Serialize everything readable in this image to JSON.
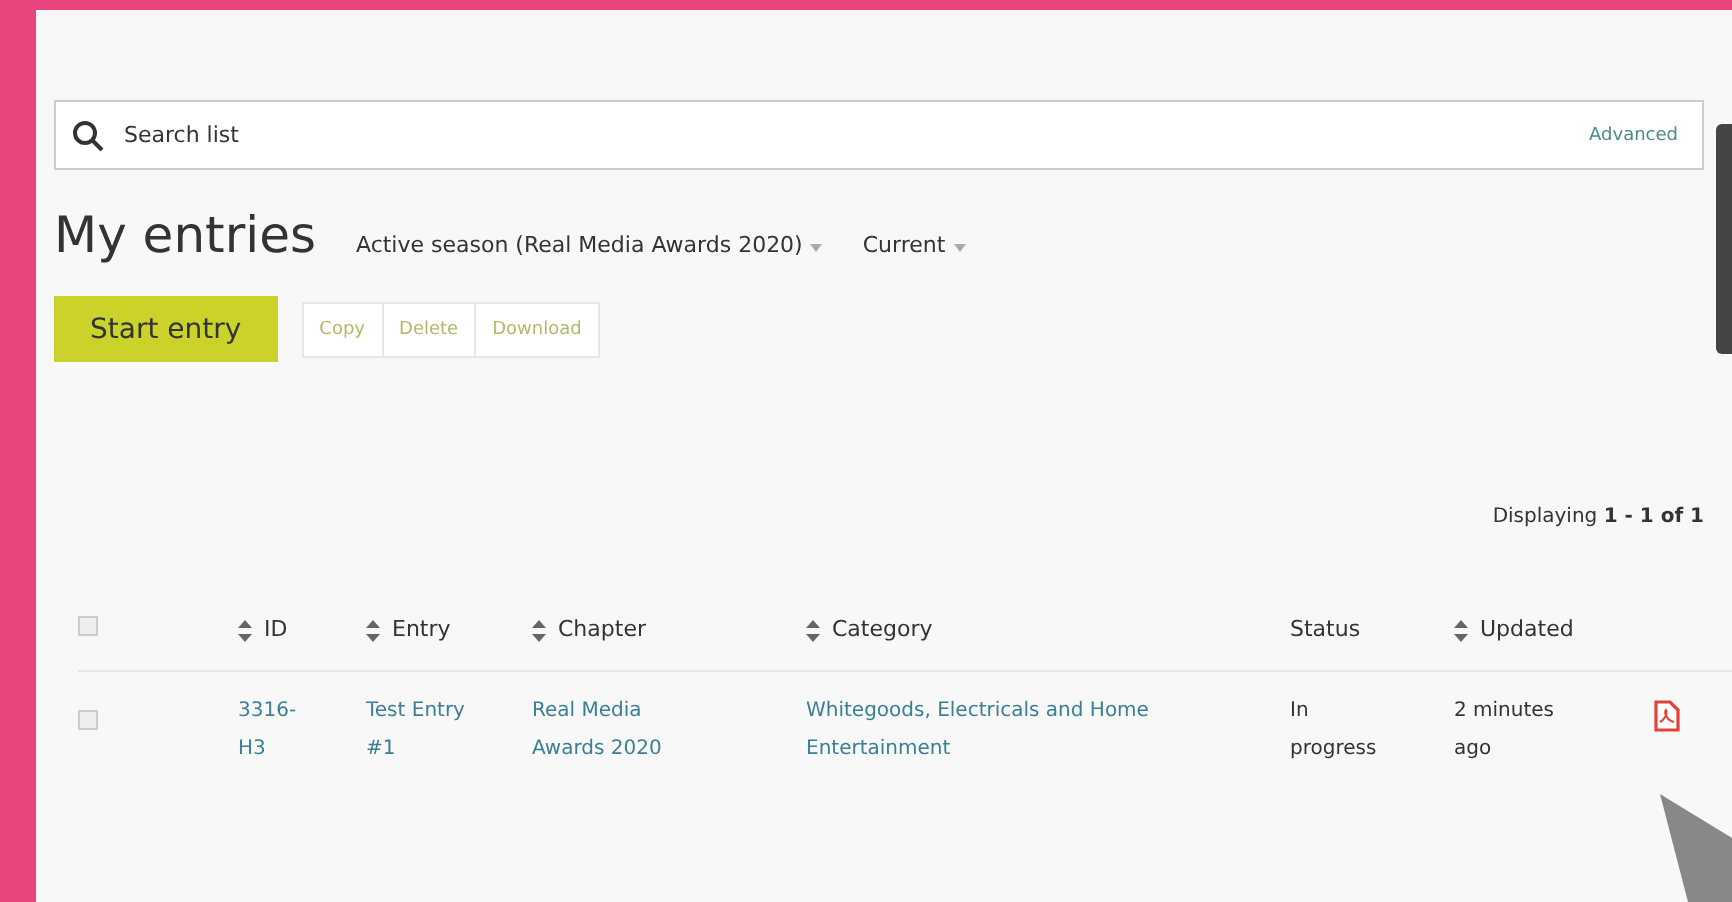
{
  "search": {
    "placeholder": "Search list",
    "advanced": "Advanced"
  },
  "title": "My entries",
  "filters": [
    {
      "label": "Active season (Real Media Awards 2020)"
    },
    {
      "label": "Current"
    }
  ],
  "primary_button": "Start entry",
  "actions": [
    {
      "label": "Copy",
      "disabled": true
    },
    {
      "label": "Delete",
      "disabled": true
    },
    {
      "label": "Download",
      "disabled": true
    }
  ],
  "pagination": "Displaying **1 - 1 of 1**",
  "table": {
    "select_all": {
      "checked": false
    },
    "columns": [
      {
        "kind": "check"
      },
      {
        "label": "ID",
        "sortable": true
      },
      {
        "label": "Entry",
        "sortable": true
      },
      {
        "label": "Chapter",
        "sortable": true
      },
      {
        "label": "Category",
        "sortable": true
      },
      {
        "label": "Status",
        "sortable": false
      },
      {
        "label": "Updated",
        "sortable": true
      },
      {
        "kind": "icon"
      }
    ],
    "rows": [
      {
        "checked": false,
        "id": "3316-H3",
        "entry": "Test Entry #1",
        "chapter": "Real Media Awards 2020",
        "category": "Whitegoods, Electricals and Home Entertainment",
        "status": "In progress",
        "updated": "2 minutes ago"
      }
    ]
  }
}
